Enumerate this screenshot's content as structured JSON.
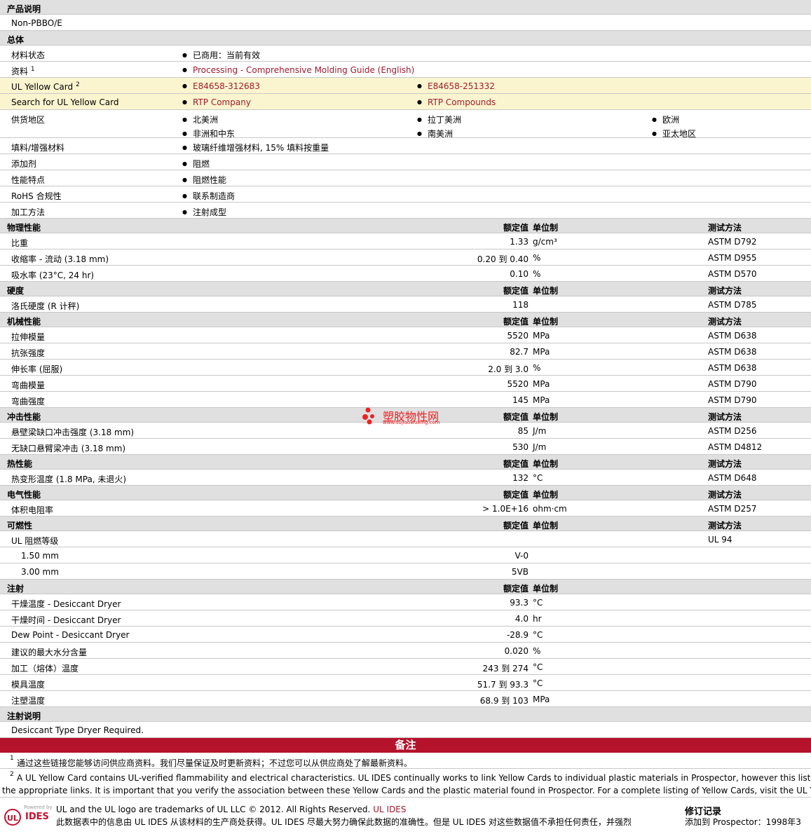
{
  "desc": {
    "title": "产品说明",
    "value": "Non-PBBO/E"
  },
  "general": {
    "title": "总体",
    "status": {
      "label": "材料状态",
      "value": "已商用：当前有效"
    },
    "docs": {
      "label": "资料",
      "sup": "1",
      "value": "Processing - Comprehensive Molding Guide (English)"
    },
    "ulcard": {
      "label": "UL Yellow Card",
      "sup": "2",
      "v1": "E84658-312683",
      "v2": "E84658-251332"
    },
    "search": {
      "label": "Search for UL Yellow Card",
      "v1": "RTP Company",
      "v2": "RTP Compounds"
    },
    "regions": {
      "label": "供货地区",
      "items": [
        "北美洲",
        "拉丁美洲",
        "欧洲",
        "非洲和中东",
        "南美洲",
        "亚太地区"
      ]
    },
    "filler": {
      "label": "填料/增强材料",
      "value": "玻璃纤维增强材料, 15% 填料按重量"
    },
    "additive": {
      "label": "添加剂",
      "value": "阻燃"
    },
    "features": {
      "label": "性能特点",
      "value": "阻燃性能"
    },
    "rohs": {
      "label": "RoHS 合规性",
      "value": "联系制造商"
    },
    "process": {
      "label": "加工方法",
      "value": "注射成型"
    }
  },
  "hdr": {
    "value": "额定值",
    "unit": "单位制",
    "method": "测试方法"
  },
  "physical": {
    "title": "物理性能",
    "rows": [
      {
        "label": "比重",
        "value": "1.33",
        "unit": "g/cm³",
        "method": "ASTM D792"
      },
      {
        "label": "收缩率 - 流动 (3.18 mm)",
        "value": "0.20 到 0.40",
        "unit": "%",
        "method": "ASTM D955"
      },
      {
        "label": "吸水率 (23°C, 24 hr)",
        "value": "0.10",
        "unit": "%",
        "method": "ASTM D570"
      }
    ]
  },
  "hardness": {
    "title": "硬度",
    "rows": [
      {
        "label": "洛氏硬度 (R 计秤)",
        "value": "118",
        "unit": "",
        "method": "ASTM D785"
      }
    ]
  },
  "mechanical": {
    "title": "机械性能",
    "rows": [
      {
        "label": "拉伸模量",
        "value": "5520",
        "unit": "MPa",
        "method": "ASTM D638"
      },
      {
        "label": "抗张强度",
        "value": "82.7",
        "unit": "MPa",
        "method": "ASTM D638"
      },
      {
        "label": "伸长率 (屈服)",
        "value": "2.0 到 3.0",
        "unit": "%",
        "method": "ASTM D638"
      },
      {
        "label": "弯曲模量",
        "value": "5520",
        "unit": "MPa",
        "method": "ASTM D790"
      },
      {
        "label": "弯曲强度",
        "value": "145",
        "unit": "MPa",
        "method": "ASTM D790"
      }
    ]
  },
  "impact": {
    "title": "冲击性能",
    "rows": [
      {
        "label": "悬壁梁缺口冲击强度 (3.18 mm)",
        "value": "85",
        "unit": "J/m",
        "method": "ASTM D256"
      },
      {
        "label": "无缺口悬臂梁冲击 (3.18 mm)",
        "value": "530",
        "unit": "J/m",
        "method": "ASTM D4812"
      }
    ]
  },
  "thermal": {
    "title": "热性能",
    "rows": [
      {
        "label": "热变形温度 (1.8 MPa, 未退火)",
        "value": "132",
        "unit": "°C",
        "method": "ASTM D648"
      }
    ]
  },
  "electrical": {
    "title": "电气性能",
    "rows": [
      {
        "label": "体积电阻率",
        "value": "> 1.0E+16",
        "unit": "ohm·cm",
        "method": "ASTM D257"
      }
    ]
  },
  "flammability": {
    "title": "可燃性",
    "rating_label": "UL 阻燃等级",
    "rating_method": "UL 94",
    "rows": [
      {
        "label": "1.50 mm",
        "value": "V-0"
      },
      {
        "label": "3.00 mm",
        "value": "5VB"
      }
    ]
  },
  "injection": {
    "title": "注射",
    "rows": [
      {
        "label": "干燥温度 - Desiccant Dryer",
        "value": "93.3",
        "unit": "°C"
      },
      {
        "label": "干燥时间 - Desiccant Dryer",
        "value": "4.0",
        "unit": "hr"
      },
      {
        "label": "Dew Point - Desiccant Dryer",
        "value": "-28.9",
        "unit": "°C"
      },
      {
        "label": "建议的最大水分含量",
        "value": "0.020",
        "unit": "%"
      },
      {
        "label": "加工（熔体）温度",
        "value": "243 到 274",
        "unit": "°C"
      },
      {
        "label": "模具温度",
        "value": "51.7 到 93.3",
        "unit": "°C"
      },
      {
        "label": "注塑温度",
        "value": "68.9 到 103",
        "unit": "MPa"
      }
    ]
  },
  "inj_notes": {
    "title": "注射说明",
    "value": "Desiccant Type Dryer Required."
  },
  "notes": {
    "title": "备注",
    "n1": "通过这些链接您能够访问供应商资料。我们尽量保证及时更新资料；不过您可以从供应商处了解最新资料。",
    "n2a": "A UL Yellow Card contains UL-verified flammability and electrical characteristics. UL IDES continually works to link Yellow Cards to individual plastic materials in Prospector, however this list may n",
    "n2b": "the appropriate links. It is important that you verify the association between these Yellow Cards and the plastic material found in Prospector. For a complete listing of Yellow Cards, visit the UL Yellow C"
  },
  "footer": {
    "trademark": "UL and the UL logo are trademarks of UL LLC © 2012. All Rights Reserved.",
    "ides_link": "UL IDES",
    "disclaimer": "此数据表中的信息由 UL IDES 从该材料的生产商处获得。UL IDES 尽最大努力确保此数据的准确性。但是 UL IDES 对这些数据值不承担任何责任，并强烈",
    "revision_title": "修订记录",
    "revision_text": "添加到 Prospector：1998年3",
    "logo_text": "UL",
    "logo_sub": "IDES",
    "logo_powered": "Powered by"
  },
  "watermark": {
    "name": "塑胶物性网",
    "url": "www.sujiaowuxing.com"
  }
}
